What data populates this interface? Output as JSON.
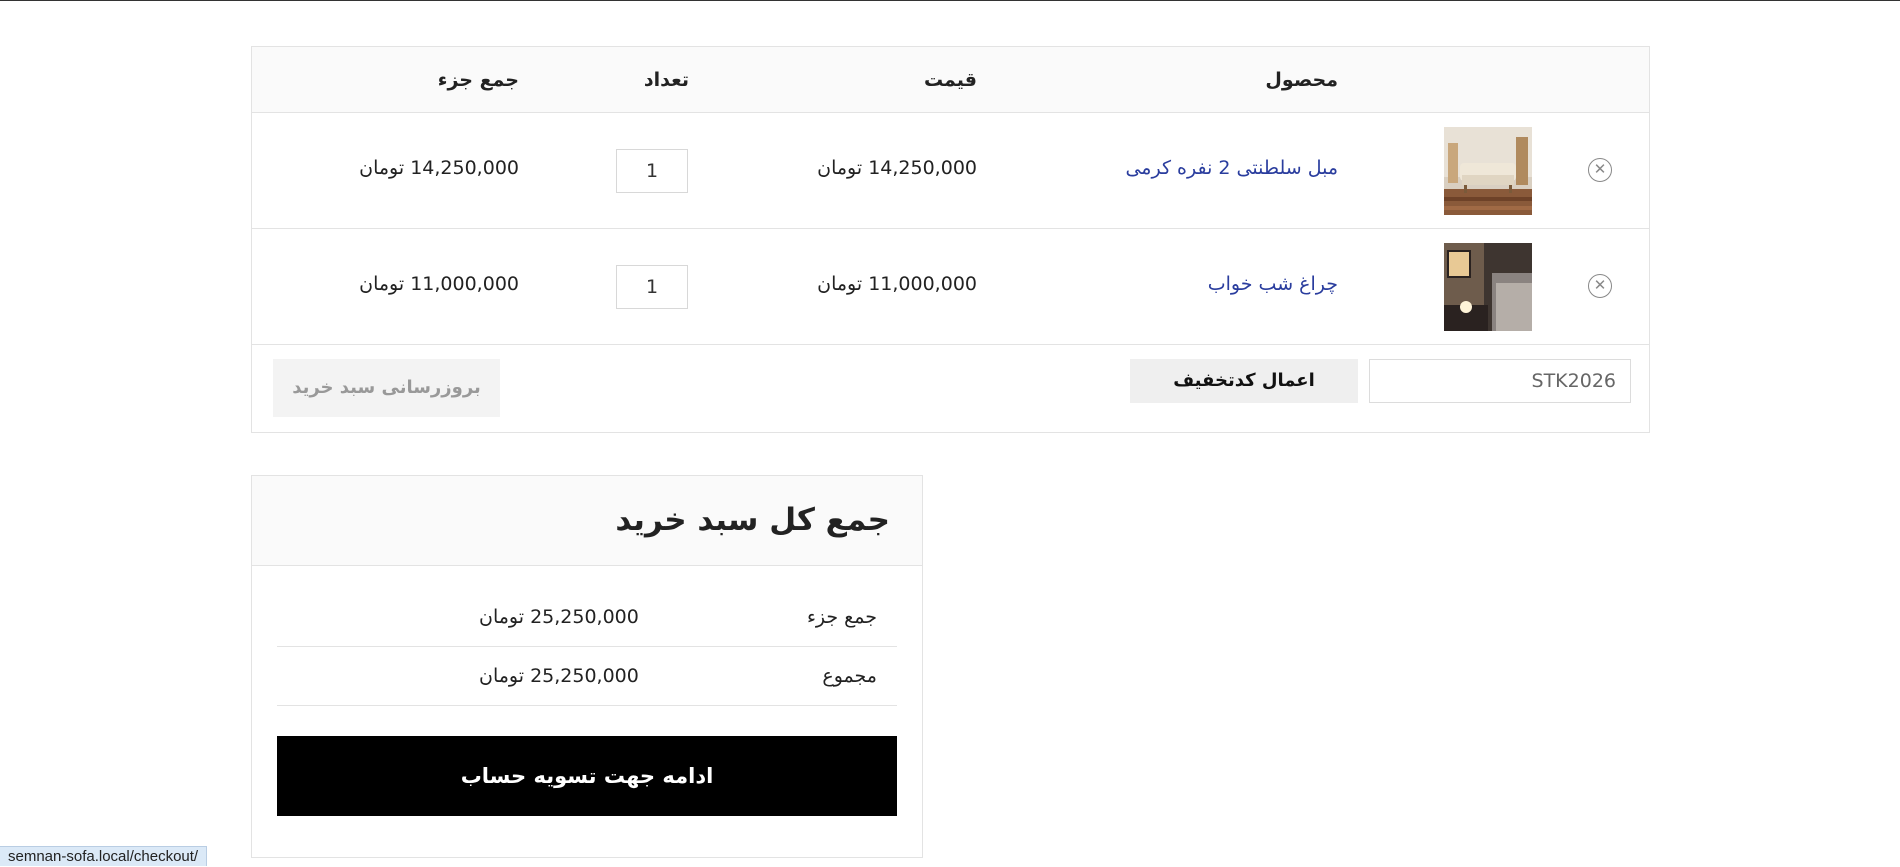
{
  "cart": {
    "headers": {
      "product": "محصول",
      "price": "قیمت",
      "quantity": "تعداد",
      "subtotal": "جمع جزء"
    },
    "items": [
      {
        "name": "مبل سلطنتی 2 نفره کرمی",
        "price": "14,250,000 تومان",
        "quantity": "1",
        "subtotal": "14,250,000 تومان"
      },
      {
        "name": "چراغ شب خواب",
        "price": "11,000,000 تومان",
        "quantity": "1",
        "subtotal": "11,000,000 تومان"
      }
    ],
    "coupon_code": "STK2026",
    "apply_coupon_label": "اعمال کدتخفیف",
    "update_cart_label": "بروزرسانی سبد خرید",
    "remove_icon": "close-circle-icon"
  },
  "totals": {
    "title": "جمع کل سبد خرید",
    "subtotal_label": "جمع جزء",
    "subtotal_value": "25,250,000 تومان",
    "total_label": "مجموع",
    "total_value": "25,250,000 تومان",
    "checkout_label": "ادامه جهت تسویه حساب"
  },
  "status_bar": {
    "url": "semnan-sofa.local/checkout/"
  },
  "colors": {
    "link": "#2a3d9e",
    "checkout_bg": "#000000",
    "header_bg": "#fafafa"
  }
}
